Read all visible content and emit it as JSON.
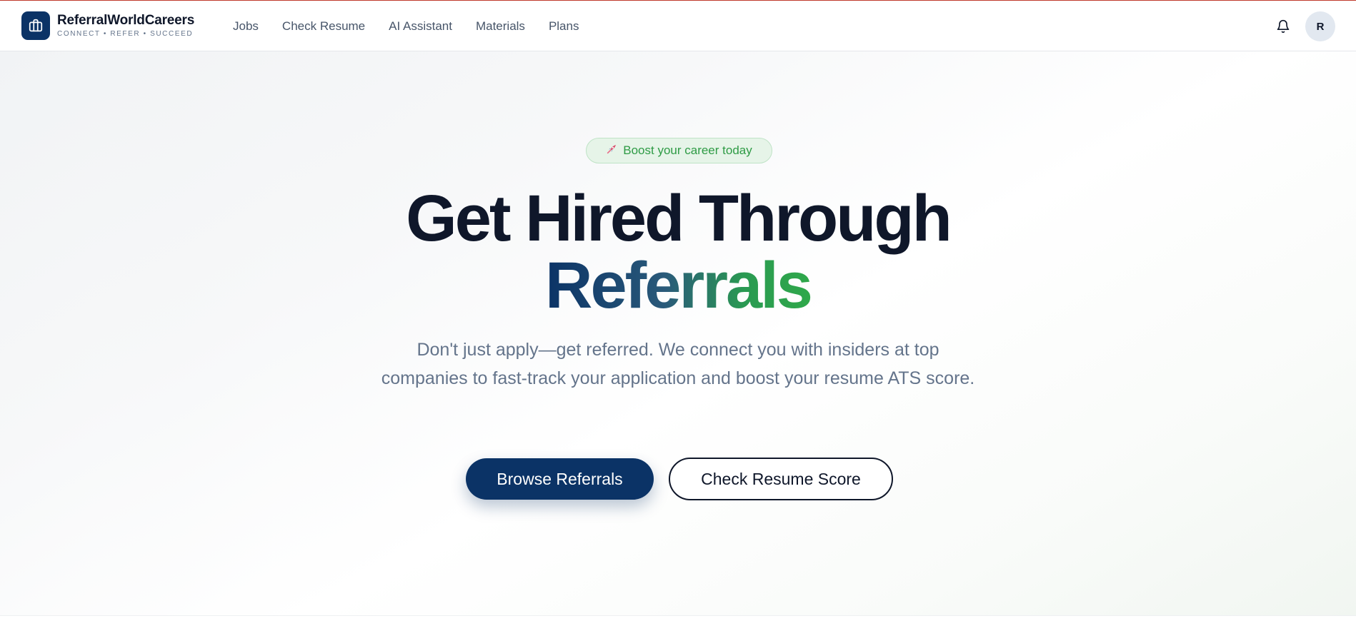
{
  "brand": {
    "name": "ReferralWorldCareers",
    "tagline": "CONNECT • REFER • SUCCEED"
  },
  "nav": {
    "items": [
      {
        "label": "Jobs"
      },
      {
        "label": "Check Resume"
      },
      {
        "label": "AI Assistant"
      },
      {
        "label": "Materials"
      },
      {
        "label": "Plans"
      }
    ]
  },
  "header": {
    "notifications_icon": "bell-icon",
    "avatar_initial": "R"
  },
  "hero": {
    "badge_icon": "rocket-icon",
    "badge_text": "Boost your career today",
    "headline_line1": "Get Hired Through",
    "headline_line2": "Referrals",
    "subtitle": "Don't just apply—get referred. We connect you with insiders at top companies to fast-track your application and boost your resume ATS score.",
    "primary_cta": "Browse Referrals",
    "secondary_cta": "Check Resume Score"
  },
  "colors": {
    "brand_navy": "#0b3366",
    "accent_green": "#2fa84a",
    "text_dark": "#0f172a",
    "text_muted": "#64748b"
  }
}
